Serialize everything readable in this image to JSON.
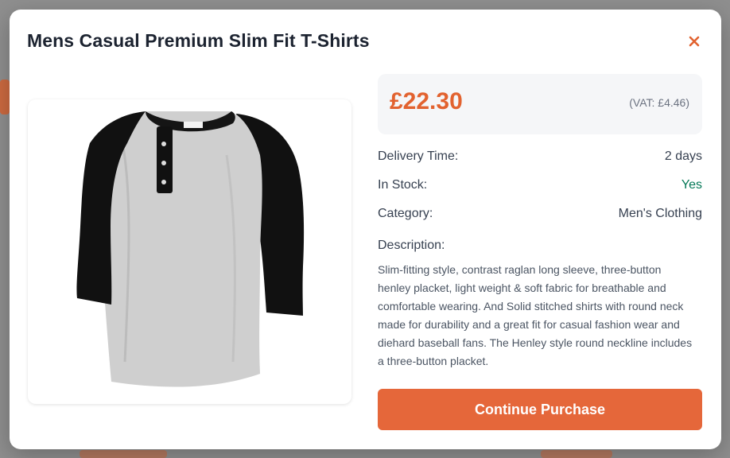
{
  "product": {
    "title": "Mens Casual Premium Slim Fit T-Shirts",
    "image_alt": "henley-tshirt-image"
  },
  "pricing": {
    "price": "£22.30",
    "vat": "(VAT: £4.46)"
  },
  "details": {
    "delivery_label": "Delivery Time:",
    "delivery_value": "2 days",
    "stock_label": "In Stock:",
    "stock_value": "Yes",
    "category_label": "Category:",
    "category_value": "Men's Clothing"
  },
  "description": {
    "label": "Description:",
    "text": "Slim-fitting style, contrast raglan long sleeve, three-button henley placket, light weight & soft fabric for breathable and comfortable wearing. And Solid stitched shirts with round neck made for durability and a great fit for casual fashion wear and diehard baseball fans. The Henley style round neckline includes a three-button placket."
  },
  "actions": {
    "close_icon": "close-icon",
    "continue_label": "Continue Purchase"
  },
  "colors": {
    "accent": "#e5673a",
    "price": "#e2622f",
    "in_stock": "#047857"
  }
}
